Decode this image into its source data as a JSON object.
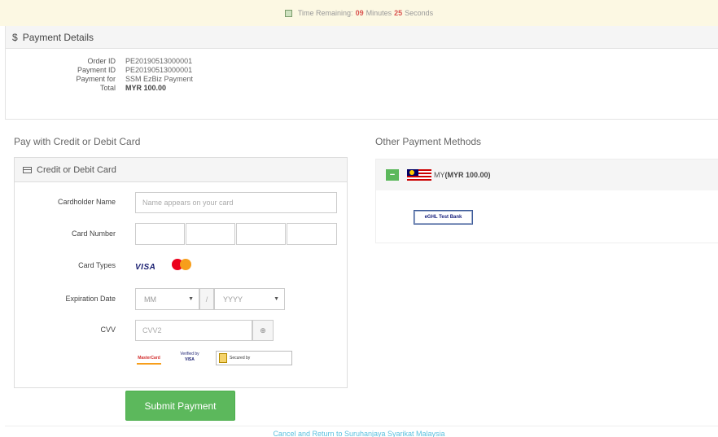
{
  "timer": {
    "label": "Time Remaining:",
    "minutes": "09",
    "minutes_unit": "Minutes",
    "seconds": "25",
    "seconds_unit": "Seconds"
  },
  "payment_details": {
    "heading": "Payment Details",
    "rows": [
      {
        "label": "Order ID",
        "value": "PE20190513000001"
      },
      {
        "label": "Payment ID",
        "value": "PE20190513000001"
      },
      {
        "label": "Payment for",
        "value": "SSM EzBiz Payment"
      },
      {
        "label": "Total",
        "value": "MYR 100.00"
      }
    ]
  },
  "card_section": {
    "title": "Pay with Credit or Debit Card",
    "panel_heading": "Credit or Debit Card",
    "cardholder_label": "Cardholder Name",
    "cardholder_placeholder": "Name appears on your card",
    "card_number_label": "Card Number",
    "card_types_label": "Card Types",
    "visa_text": "VISA",
    "mastercard_text": "MasterCard",
    "expiration_label": "Expiration Date",
    "month_placeholder": "MM",
    "separator": "/",
    "year_placeholder": "YYYY",
    "cvv_label": "CVV",
    "cvv_placeholder": "CVV2",
    "badges": {
      "mc_securecode": "MasterCard SecureCode",
      "verified_by_visa": "Verified by VISA",
      "secured_by": "Secured by"
    },
    "submit_label": "Submit Payment"
  },
  "other_methods": {
    "title": "Other Payment Methods",
    "currency_code": "MY",
    "currency_amount": "(MYR 100.00)",
    "bank_button": "eGHL Test Bank"
  },
  "footer": {
    "cancel_link": "Cancel and Return to Suruhanjaya Syarikat Malaysia"
  },
  "colors": {
    "timer_bg": "#fcf8e3",
    "accent_green": "#5cb85c",
    "link_blue": "#5bc0de",
    "timer_highlight": "#d9534f"
  }
}
